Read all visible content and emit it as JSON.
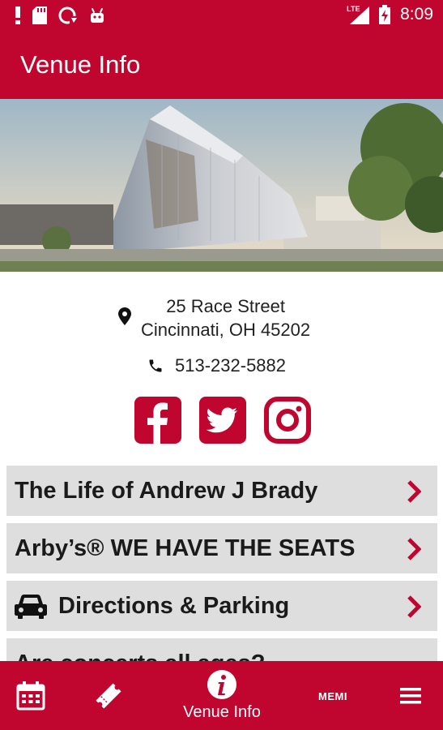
{
  "status_bar": {
    "time": "8:09",
    "network": "LTE",
    "icons": [
      "alert-icon",
      "sd-card-icon",
      "sync-icon",
      "android-icon",
      "signal-icon",
      "battery-charging-icon"
    ]
  },
  "app_bar": {
    "title": "Venue Info"
  },
  "hero": {
    "image_description": "venue-building-rendering"
  },
  "venue": {
    "address_line1": "25 Race Street",
    "address_line2": "Cincinnati, OH 45202",
    "phone": "513-232-5882"
  },
  "social": [
    "facebook-icon",
    "twitter-icon",
    "instagram-icon"
  ],
  "list_items": [
    {
      "label": "The Life of Andrew J Brady"
    },
    {
      "label": "Arby’s® WE HAVE THE SEATS"
    },
    {
      "label": "Directions & Parking",
      "icon": "car-icon"
    },
    {
      "label": "Are concerts all ages?"
    }
  ],
  "bottom_nav": {
    "items": [
      {
        "icon": "calendar-icon"
      },
      {
        "icon": "ticket-icon"
      },
      {
        "icon": "info-icon",
        "label": "Venue Info",
        "active": true
      },
      {
        "label": "MEMI"
      },
      {
        "icon": "menu-icon"
      }
    ]
  },
  "colors": {
    "brand": "#c0062e",
    "row_bg": "#dedede"
  }
}
